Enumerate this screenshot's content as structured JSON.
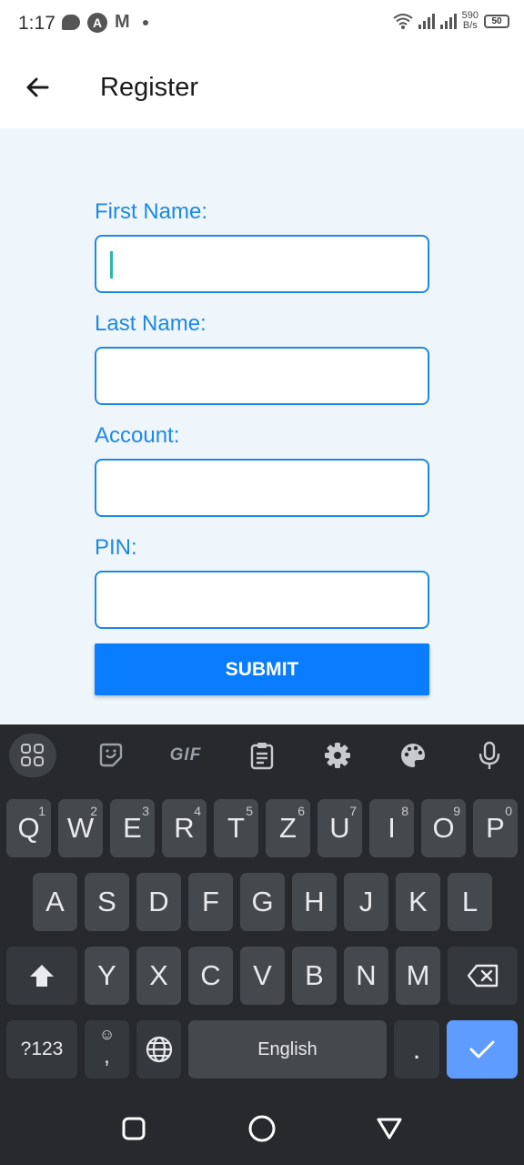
{
  "status_bar": {
    "time": "1:17",
    "net_speed_value": "590",
    "net_speed_unit": "B/s",
    "battery": "50"
  },
  "app_bar": {
    "title": "Register",
    "back_icon": "arrow-back-icon"
  },
  "form": {
    "fields": [
      {
        "label": "First Name:",
        "value": "",
        "focused": true
      },
      {
        "label": "Last Name:",
        "value": ""
      },
      {
        "label": "Account:",
        "value": ""
      },
      {
        "label": "PIN:",
        "value": ""
      }
    ],
    "submit_label": "SUBMIT"
  },
  "keyboard": {
    "toolbar": [
      "apps-grid-icon",
      "sticker-icon",
      "gif-icon",
      "clipboard-icon",
      "settings-icon",
      "palette-icon",
      "mic-icon"
    ],
    "gif_label": "GIF",
    "row1": [
      {
        "key": "Q",
        "hint": "1"
      },
      {
        "key": "W",
        "hint": "2"
      },
      {
        "key": "E",
        "hint": "3"
      },
      {
        "key": "R",
        "hint": "4"
      },
      {
        "key": "T",
        "hint": "5"
      },
      {
        "key": "Z",
        "hint": "6"
      },
      {
        "key": "U",
        "hint": "7"
      },
      {
        "key": "I",
        "hint": "8"
      },
      {
        "key": "O",
        "hint": "9"
      },
      {
        "key": "P",
        "hint": "0"
      }
    ],
    "row2": [
      "A",
      "S",
      "D",
      "F",
      "G",
      "H",
      "J",
      "K",
      "L"
    ],
    "row3": [
      "Y",
      "X",
      "C",
      "V",
      "B",
      "N",
      "M"
    ],
    "symbols_label": "?123",
    "comma_label": ",",
    "space_label": "English",
    "period_label": ".",
    "colors": {
      "background": "#27292c",
      "key": "#45484c",
      "enter": "#5e9cff"
    }
  },
  "nav_bar": [
    "recents-icon",
    "home-icon",
    "back-triangle-icon"
  ],
  "colors": {
    "accent": "#1e88e5",
    "submit": "#0a7cff",
    "form_bg": "#eef6fc"
  }
}
